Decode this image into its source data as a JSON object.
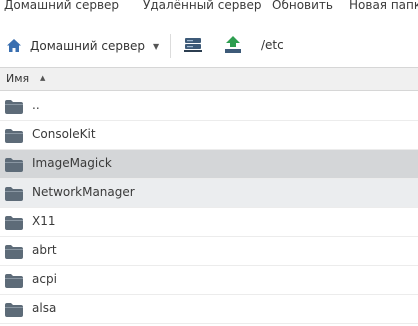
{
  "menu": {
    "items": [
      "Домашний сервер",
      "Удалённый сервер",
      "Обновить",
      "Новая папка"
    ]
  },
  "toolbar": {
    "server_label": "Домашний сервер",
    "path": "/etc"
  },
  "columns": {
    "name_header": "Имя",
    "sort": "ascending"
  },
  "files": {
    "rows": [
      {
        "name": "..",
        "state": "normal"
      },
      {
        "name": "ConsoleKit",
        "state": "normal"
      },
      {
        "name": "ImageMagick",
        "state": "selected"
      },
      {
        "name": "NetworkManager",
        "state": "hover"
      },
      {
        "name": "X11",
        "state": "normal"
      },
      {
        "name": "abrt",
        "state": "normal"
      },
      {
        "name": "acpi",
        "state": "normal"
      },
      {
        "name": "alsa",
        "state": "normal"
      }
    ]
  },
  "colors": {
    "folder": "#5d6b78",
    "selected_row": "#d4d6d8",
    "hover_row": "#ebedef",
    "home_icon": "#3a6fb0",
    "upload_icon": "#2e9e50",
    "server_icon": "#3d5a78"
  },
  "icons": {
    "home": "home-icon",
    "server": "server-icon",
    "upload": "upload-icon",
    "folder": "folder-icon"
  }
}
